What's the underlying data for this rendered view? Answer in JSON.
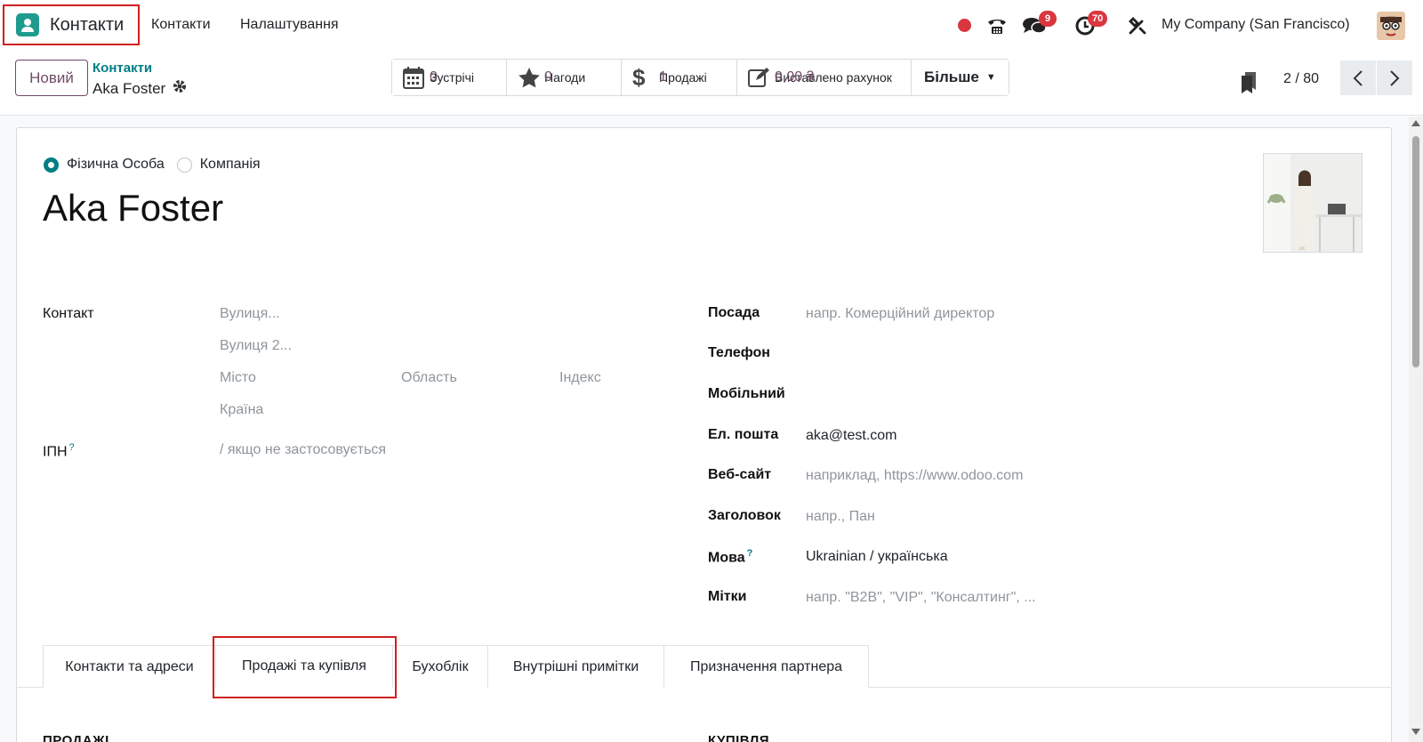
{
  "navbar": {
    "app_name": "Контакти",
    "menu": [
      "Контакти",
      "Налаштування"
    ],
    "messages_count": "9",
    "activities_count": "70",
    "company": "My Company (San Francisco)"
  },
  "control_panel": {
    "new_button": "Новий",
    "breadcrumb_parent": "Контакти",
    "breadcrumb_current": "Aka Foster",
    "smart_buttons": [
      {
        "label": "Зустрічі",
        "value": "0"
      },
      {
        "label": "Нагоди",
        "value": "0"
      },
      {
        "label": "Продажі",
        "value": "1"
      },
      {
        "label": "Виставлено рахунок",
        "value": "0,00 ₴"
      }
    ],
    "more_button": "Більше",
    "pager": "2 / 80"
  },
  "form": {
    "type_individual": "Фізична Особа",
    "type_company": "Компанія",
    "name": "Aka Foster",
    "left": {
      "contact_label": "Контакт",
      "street_placeholder": "Вулиця...",
      "street2_placeholder": "Вулиця 2...",
      "city_placeholder": "Місто",
      "state_placeholder": "Область",
      "zip_placeholder": "Індекс",
      "country_placeholder": "Країна",
      "vat_label": "ІПН",
      "vat_placeholder": "/ якщо не застосовується"
    },
    "right": {
      "job_label": "Посада",
      "job_placeholder": "напр. Комерційний директор",
      "phone_label": "Телефон",
      "mobile_label": "Мобільний",
      "email_label": "Ел. пошта",
      "email_value": "aka@test.com",
      "website_label": "Веб-сайт",
      "website_placeholder": "наприклад, https://www.odoo.com",
      "title_label": "Заголовок",
      "title_placeholder": "напр., Пан",
      "lang_label": "Мова",
      "lang_value": "Ukrainian / українська",
      "tags_label": "Мітки",
      "tags_placeholder": "напр. \"B2B\", \"VIP\", \"Консалтинг\", ..."
    }
  },
  "tabs": [
    "Контакти та адреси",
    "Продажі та купівля",
    "Бухоблік",
    "Внутрішні примітки",
    "Призначення партнера"
  ],
  "sections": {
    "sales": "ПРОДАЖІ",
    "purchase": "КУПІВЛЯ"
  },
  "colors": {
    "accent": "#714b67",
    "teal": "#017e84",
    "highlight": "#d0201f"
  }
}
